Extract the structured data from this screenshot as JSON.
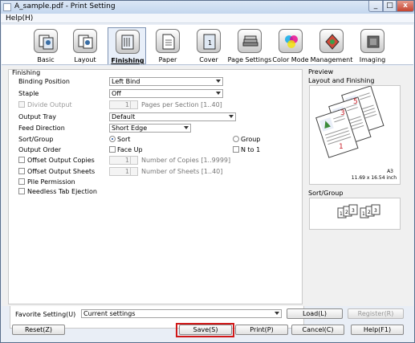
{
  "window": {
    "title": "A_sample.pdf - Print Setting",
    "controls": {
      "min": "_",
      "max": "□",
      "close": "x"
    }
  },
  "menubar": {
    "help": "Help(H)"
  },
  "tabs": [
    {
      "label": "Basic",
      "icon": "basic-icon"
    },
    {
      "label": "Layout",
      "icon": "layout-icon"
    },
    {
      "label": "Finishing",
      "icon": "finishing-icon",
      "active": true
    },
    {
      "label": "Paper",
      "icon": "paper-icon"
    },
    {
      "label": "Cover",
      "icon": "cover-icon"
    },
    {
      "label": "Page Settings",
      "icon": "page-settings-icon"
    },
    {
      "label": "Color Mode",
      "icon": "color-mode-icon"
    },
    {
      "label": "Management",
      "icon": "management-icon"
    },
    {
      "label": "Imaging",
      "icon": "imaging-icon"
    }
  ],
  "nav": {
    "prev": "«",
    "next": "»"
  },
  "finishing": {
    "section_title": "Finishing",
    "binding_position": {
      "label": "Binding Position",
      "value": "Left Bind"
    },
    "staple": {
      "label": "Staple",
      "value": "Off"
    },
    "divide_output": {
      "label": "Divide Output",
      "value": "1",
      "hint": "Pages per Section [1..40]"
    },
    "output_tray": {
      "label": "Output Tray",
      "value": "Default"
    },
    "feed_direction": {
      "label": "Feed Direction",
      "value": "Short Edge"
    },
    "sort_group": {
      "label": "Sort/Group",
      "sort": "Sort",
      "group": "Group"
    },
    "output_order": {
      "label": "Output Order",
      "face_up": "Face Up",
      "n_to_1": "N to 1"
    },
    "offset_output_copies": {
      "label": "Offset Output Copies",
      "value": "1",
      "hint": "Number of Copies [1..9999]"
    },
    "offset_output_sheets": {
      "label": "Offset Output Sheets",
      "value": "1",
      "hint": "Number of Sheets  [1..40]"
    },
    "pile_permission": {
      "label": "Pile Permission"
    },
    "needless_tab_ejection": {
      "label": "Needless Tab Ejection"
    }
  },
  "preview": {
    "title": "Preview",
    "layout_finishing": "Layout and Finishing",
    "page_numbers": [
      "5",
      "3",
      "1"
    ],
    "paper_size": "A3",
    "paper_dims": "11.69 x 16.54 inch",
    "sort_group_title": "Sort/Group",
    "sort_stack_labels": [
      "3",
      "2",
      "1"
    ]
  },
  "favorite": {
    "label": "Favorite Setting(U)",
    "value": "Current settings",
    "load": "Load(L)",
    "register": "Register(R)"
  },
  "buttons": {
    "reset": "Reset(Z)",
    "save": "Save(S)",
    "print": "Print(P)",
    "cancel": "Cancel(C)",
    "help": "Help(F1)"
  }
}
